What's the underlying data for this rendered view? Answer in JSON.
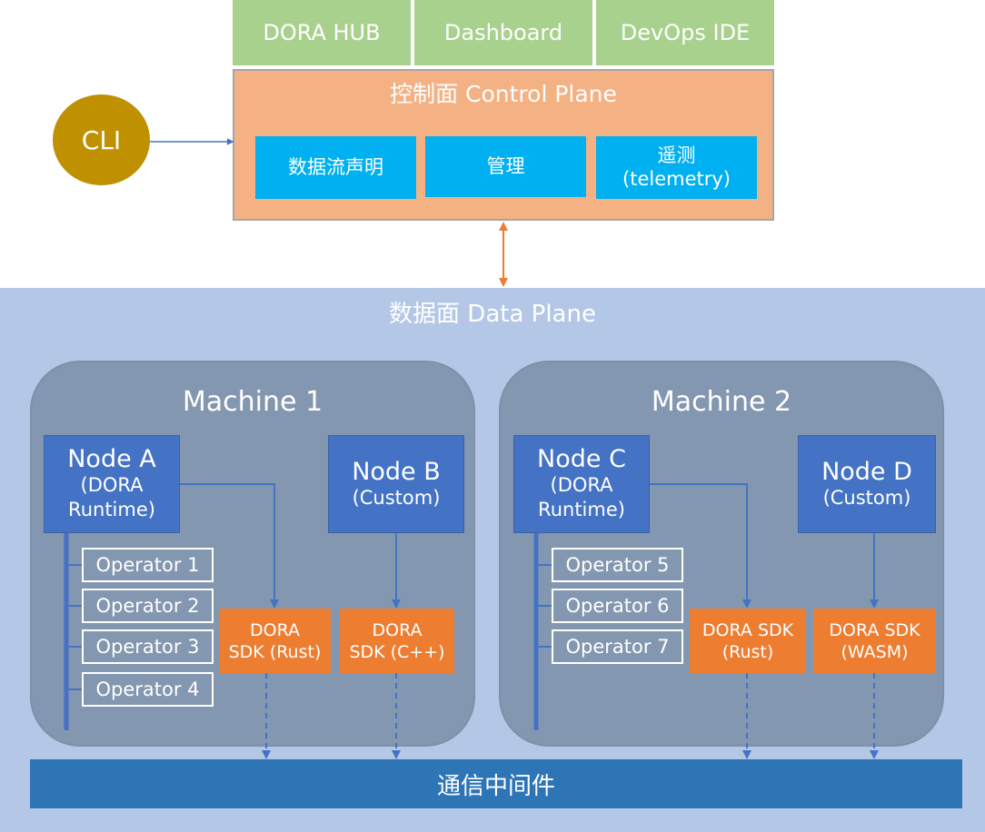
{
  "top_tabs": {
    "hub": "DORA HUB",
    "dashboard": "Dashboard",
    "ide": "DevOps IDE"
  },
  "control_plane": {
    "title": "控制面 Control Plane",
    "boxes": {
      "dataflow": "数据流声明",
      "management": "管理",
      "telemetry_1": "遥测",
      "telemetry_2": "(telemetry)"
    }
  },
  "cli": {
    "label": "CLI"
  },
  "data_plane": {
    "title": "数据面 Data Plane"
  },
  "machine1": {
    "title": "Machine 1",
    "node_a": {
      "line1": "Node A",
      "line2": "(DORA",
      "line3": "Runtime)"
    },
    "node_b": {
      "line1": "Node B",
      "line2": "(Custom)"
    },
    "operators": [
      "Operator 1",
      "Operator 2",
      "Operator 3",
      "Operator 4"
    ],
    "sdk_rust": {
      "line1": "DORA",
      "line2": "SDK (Rust)"
    },
    "sdk_cpp": {
      "line1": "DORA",
      "line2": "SDK (C++)"
    }
  },
  "machine2": {
    "title": "Machine 2",
    "node_c": {
      "line1": "Node C",
      "line2": "(DORA",
      "line3": "Runtime)"
    },
    "node_d": {
      "line1": "Node D",
      "line2": "(Custom)"
    },
    "operators": [
      "Operator 5",
      "Operator 6",
      "Operator 7"
    ],
    "sdk_rust": {
      "line1": "DORA SDK",
      "line2": "(Rust)"
    },
    "sdk_wasm": {
      "line1": "DORA SDK",
      "line2": "(WASM)"
    }
  },
  "middleware": {
    "label": "通信中间件"
  },
  "colors": {
    "tab_green": "#a9d18e",
    "control_plane_orange": "#f4b183",
    "cyan_box": "#00b0f0",
    "cli_gold": "#bf9000",
    "data_plane_blue": "#b4c7e7",
    "machine_gray": "#8497b0",
    "node_blue": "#4472c4",
    "sdk_orange": "#ed7d31",
    "bus_blue": "#2e75b6",
    "arrow_orange": "#ed7d31"
  }
}
